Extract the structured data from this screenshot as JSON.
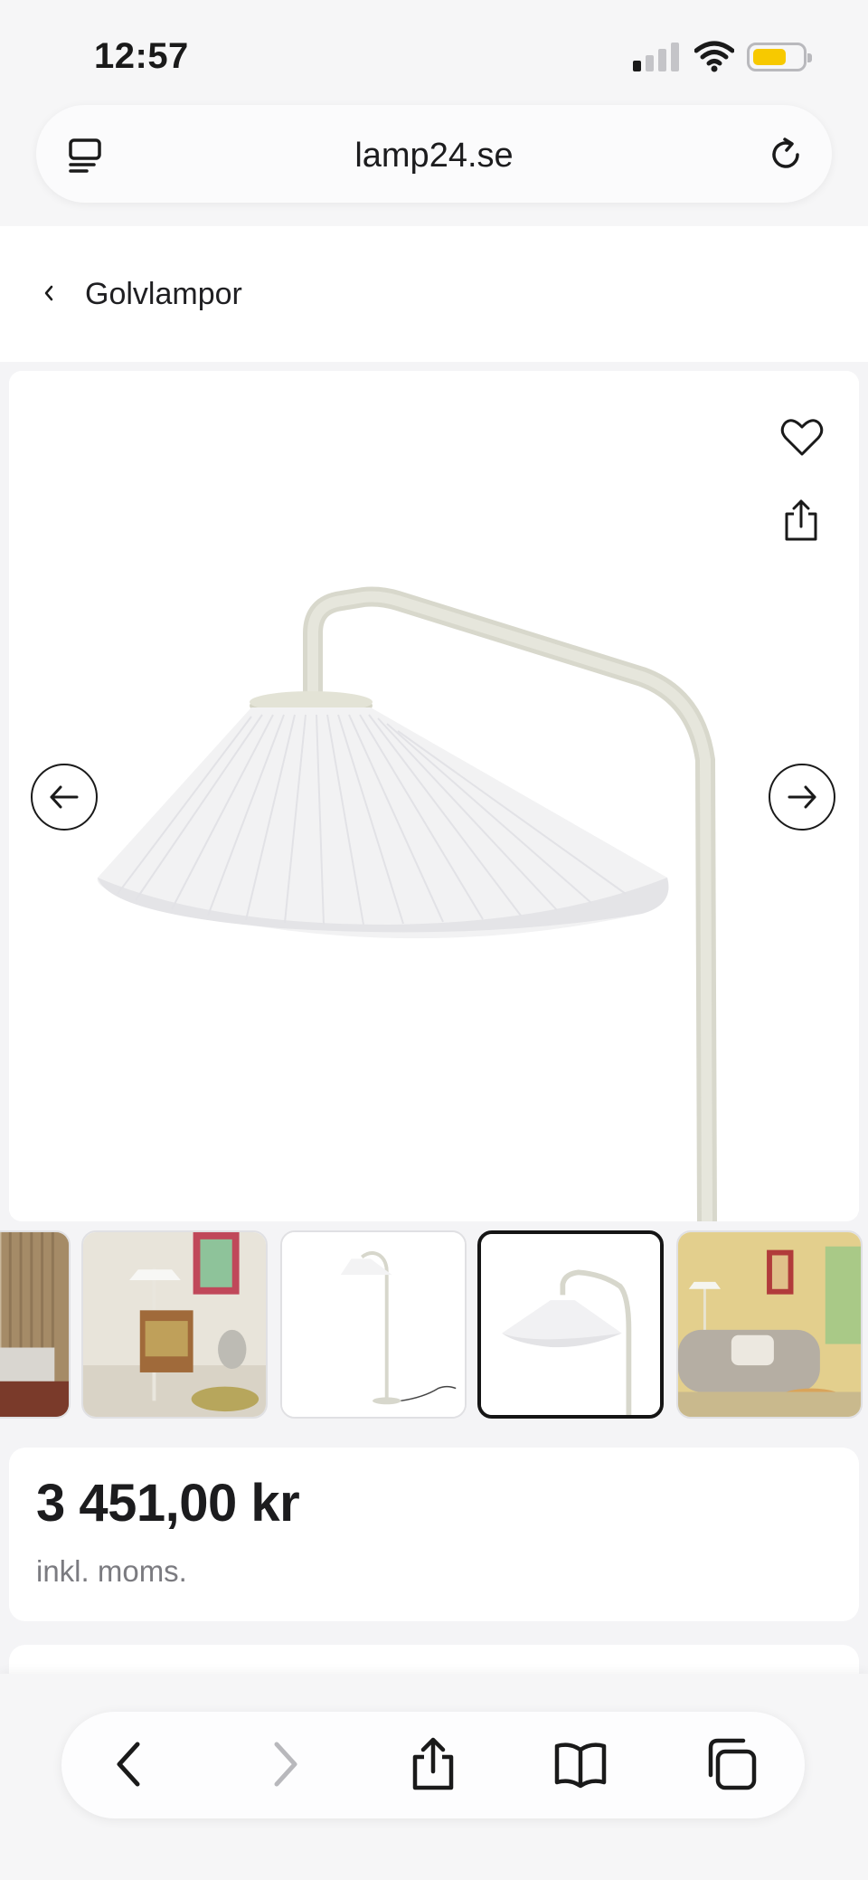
{
  "status_bar": {
    "time": "12:57",
    "signal_bars_active": 1,
    "battery_color": "#f7c900"
  },
  "browser": {
    "url": "lamp24.se",
    "icons": [
      "tab-overview-icon",
      "reload-icon"
    ]
  },
  "breadcrumb": {
    "label": "Golvlampor",
    "icon": "chevron-left-icon"
  },
  "gallery": {
    "icons": [
      "heart-icon",
      "share-icon",
      "arrow-left-icon",
      "arrow-right-icon"
    ],
    "main_image": "floor lamp with white pleated shade",
    "thumbnails": [
      {
        "name": "thumb-curtain-room",
        "active": false
      },
      {
        "name": "thumb-lamp-by-armchair",
        "active": false
      },
      {
        "name": "thumb-lamp-full-white",
        "active": false
      },
      {
        "name": "thumb-lamp-shade-closeup",
        "active": true
      },
      {
        "name": "thumb-lamp-by-sofa",
        "active": false
      }
    ]
  },
  "product": {
    "price": "3 451,00 kr",
    "vat_note": "inkl. moms."
  },
  "toolbar": {
    "icons": [
      "back-icon",
      "forward-icon",
      "share-icon",
      "bookmarks-icon",
      "tabs-icon"
    ],
    "forward_enabled": false
  }
}
